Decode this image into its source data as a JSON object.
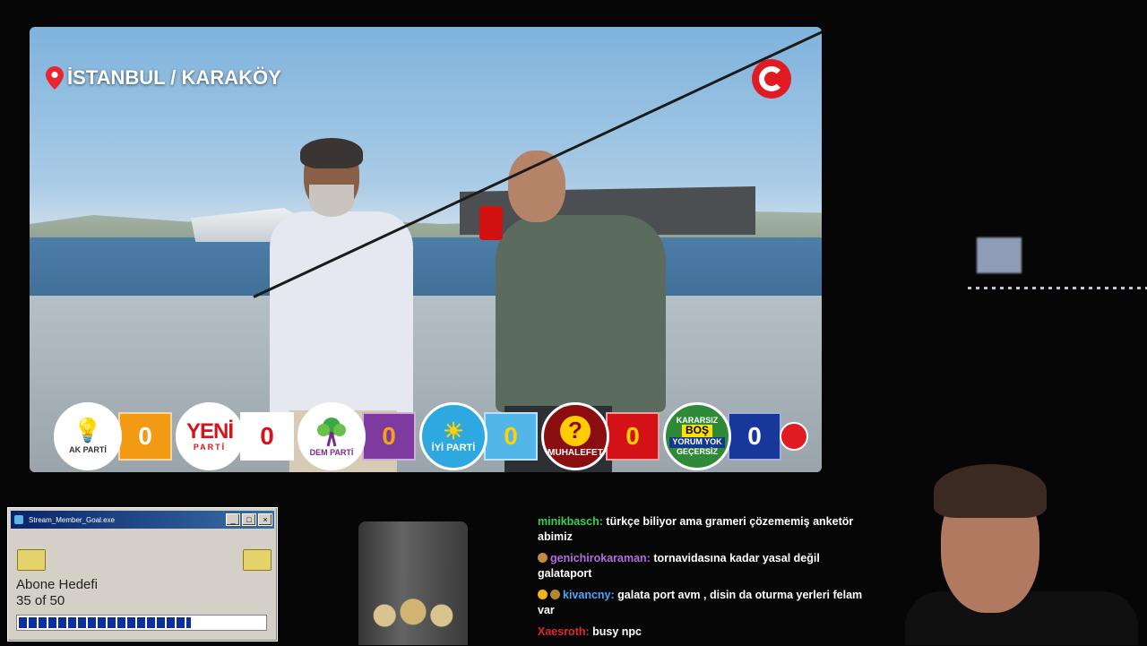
{
  "video": {
    "location": "İSTANBUL / KARAKÖY",
    "parties": [
      {
        "logo_text": "AK PARTİ",
        "votes": "0",
        "box_color": "#f39a15"
      },
      {
        "logo_text": "YENİ",
        "logo_sub": "PARTİ",
        "votes": "0",
        "box_color": "#ffffff"
      },
      {
        "logo_text": "DEM PARTİ",
        "votes": "0",
        "box_color": "#7f3aa0"
      },
      {
        "logo_text": "İYİ PARTİ",
        "votes": "0",
        "box_color": "#52b6e8"
      },
      {
        "logo_text": "MUHALEFET",
        "logo_symbol": "?",
        "votes": "0",
        "box_color": "#d41116"
      },
      {
        "logo_lines": [
          "KARARSIZ",
          "BOŞ",
          "YORUM YOK",
          "GEÇERSİZ"
        ],
        "votes": "0",
        "box_color": "#17379a"
      }
    ]
  },
  "window": {
    "title": "Stream_Member_Goal.exe",
    "label": "Abone Hedefi",
    "count_text": "35 of 50",
    "progress": 0.7
  },
  "chat": {
    "messages": [
      {
        "user": "minikbasch:",
        "text": "türkçe biliyor ama grameri çözememiş anketör abimiz",
        "color": "#3bd14f"
      },
      {
        "user": "genichirokaraman:",
        "text": "tornavidasına kadar yasal değil galataport",
        "color": "#b16ee0"
      },
      {
        "user": "kivancny:",
        "text": "galata port avm , disin da oturma yerleri felam var",
        "color": "#4aa6ff"
      },
      {
        "user": "Xaesroth:",
        "text": "busy npc",
        "color": "#e0282e"
      }
    ]
  }
}
